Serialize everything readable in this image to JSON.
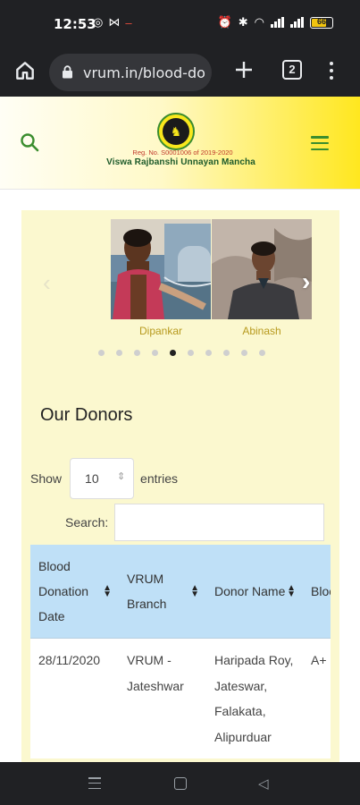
{
  "status_bar": {
    "time": "12:53",
    "battery": "66",
    "battery_level": 0.66
  },
  "browser": {
    "url": "vrum.in/blood-do",
    "tab_count": "2"
  },
  "site_header": {
    "registration": "Reg. No. S0001006 of 2019-2020",
    "org_name": "Viswa Rajbanshi Unnayan Mancha"
  },
  "carousel": {
    "donors": [
      {
        "name": "Dipankar"
      },
      {
        "name": "Abinash"
      }
    ],
    "dot_count": 10,
    "active_dot": 4
  },
  "section_title": "Our Donors",
  "table_controls": {
    "show_label": "Show",
    "page_size": "10",
    "entries_label": "entries",
    "search_label": "Search:"
  },
  "table": {
    "headers": [
      "Blood Donation Date",
      "VRUM Branch",
      "Donor Name",
      "Blood Group"
    ],
    "rows": [
      [
        "28/11/2020",
        "VRUM - Jateshwar",
        "Haripada Roy, Jateswar, Falakata, Alipurduar",
        "A+"
      ]
    ]
  },
  "colors": {
    "header_gradient_end": "#ffe71f",
    "panel_bg": "#fbf8cf",
    "table_header_bg": "#bfe0f7",
    "brand_green": "#3b8d2e"
  }
}
